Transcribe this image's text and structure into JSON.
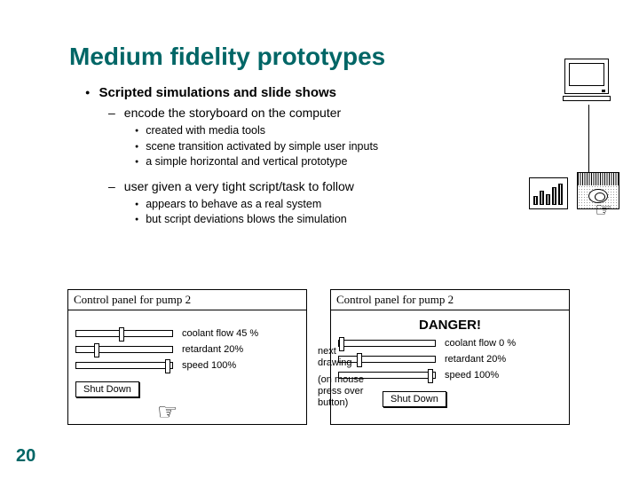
{
  "title": "Medium fidelity prototypes",
  "bullets": {
    "main": "Scripted simulations and slide shows",
    "s1": "encode the storyboard on the computer",
    "s1a": "created with media tools",
    "s1b": "scene transition activated by simple user inputs",
    "s1c": "a simple horizontal and vertical prototype",
    "s2": "user given a very tight script/task to follow",
    "s2a": "appears to behave as a real system",
    "s2b": "but  script deviations blows the simulation"
  },
  "panel1": {
    "title": "Control panel for pump 2",
    "r1": "coolant flow 45 %",
    "r2": "retardant 20%",
    "r3": "speed 100%",
    "btn": "Shut Down"
  },
  "panel2": {
    "title": "Control panel for pump 2",
    "danger": "DANGER!",
    "r1": "coolant flow 0 %",
    "r2": "retardant 20%",
    "r3": "speed 100%",
    "btn": "Shut Down"
  },
  "ann1": "next drawing",
  "ann2": "(on mouse press over button)",
  "pagenum": "20"
}
